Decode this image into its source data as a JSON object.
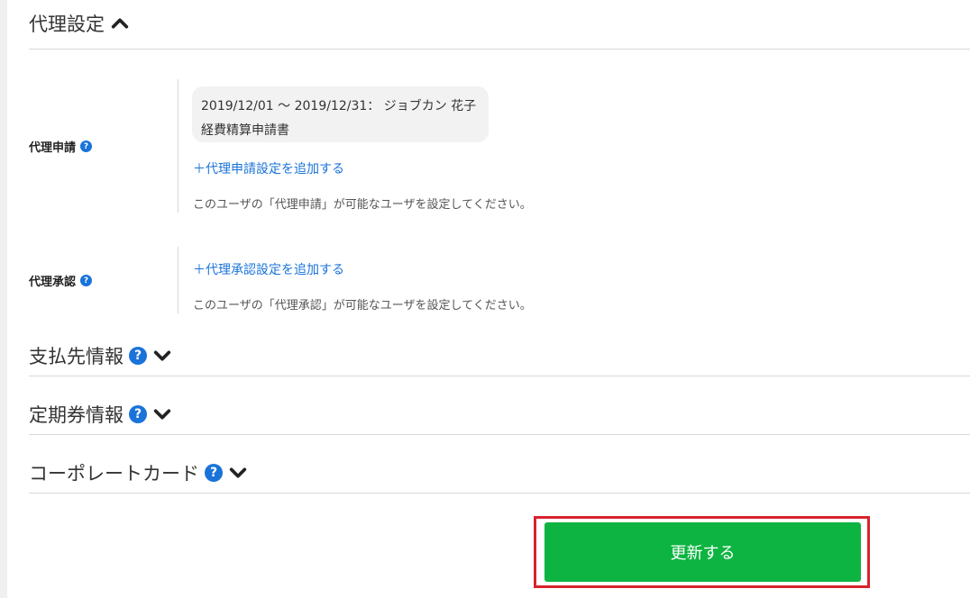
{
  "proxy_section": {
    "title": "代理設定",
    "proxy_apply": {
      "label": "代理申請",
      "entry": {
        "line1": "2019/12/01 〜 2019/12/31： ジョブカン 花子",
        "line2": "経費精算申請書"
      },
      "add_link": "＋代理申請設定を追加する",
      "note": "このユーザの「代理申請」が可能なユーザを設定してください。"
    },
    "proxy_approve": {
      "label": "代理承認",
      "add_link": "＋代理承認設定を追加する",
      "note": "このユーザの「代理承認」が可能なユーザを設定してください。"
    }
  },
  "payee_section": {
    "title": "支払先情報"
  },
  "commuter_section": {
    "title": "定期券情報"
  },
  "corporate_card_section": {
    "title": "コーポレートカード"
  },
  "help_glyph": "?",
  "update_button": {
    "label": "更新する"
  },
  "colors": {
    "accent_blue": "#1a73d9",
    "button_green": "#0db441",
    "highlight_red": "#d8232f"
  }
}
